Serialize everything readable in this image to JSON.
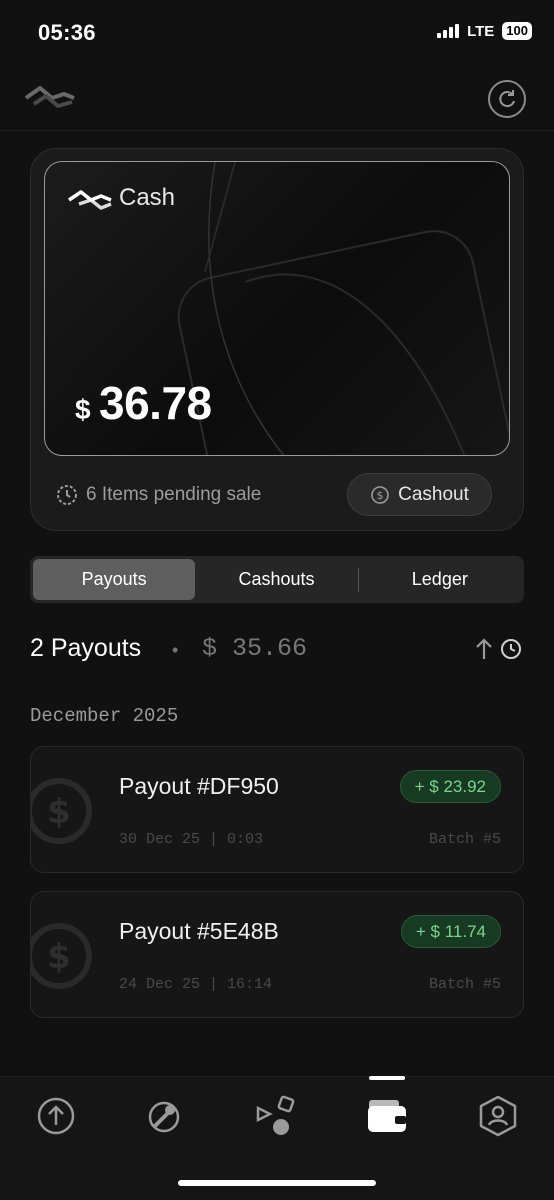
{
  "status_bar": {
    "time": "05:36",
    "network": "LTE",
    "battery": "100"
  },
  "header": {
    "logo_icon": "wave-logo-icon",
    "refresh_icon": "refresh-icon"
  },
  "card": {
    "title": "Cash",
    "currency": "$",
    "amount": "36.78",
    "pending_text": "6 Items pending sale",
    "cashout_label": "Cashout"
  },
  "tabs": [
    {
      "label": "Payouts",
      "active": true
    },
    {
      "label": "Cashouts",
      "active": false
    },
    {
      "label": "Ledger",
      "active": false
    }
  ],
  "summary": {
    "count": "2 Payouts",
    "separator": "•",
    "total": "$ 35.66"
  },
  "month_header": "December 2025",
  "payouts": [
    {
      "title": "Payout #DF950",
      "amount": "+ $ 23.92",
      "date": "30 Dec 25 | 0:03",
      "batch": "Batch #5"
    },
    {
      "title": "Payout #5E48B",
      "amount": "+ $ 11.74",
      "date": "24 Dec 25 | 16:14",
      "batch": "Batch #5"
    }
  ],
  "nav": {
    "items": [
      "upload-icon",
      "explore-icon",
      "shapes-icon",
      "wallet-icon",
      "profile-icon"
    ],
    "active": "wallet-icon"
  },
  "colors": {
    "accent_green": "#7ad68e",
    "pill_bg": "#163a22",
    "background": "#111111"
  }
}
